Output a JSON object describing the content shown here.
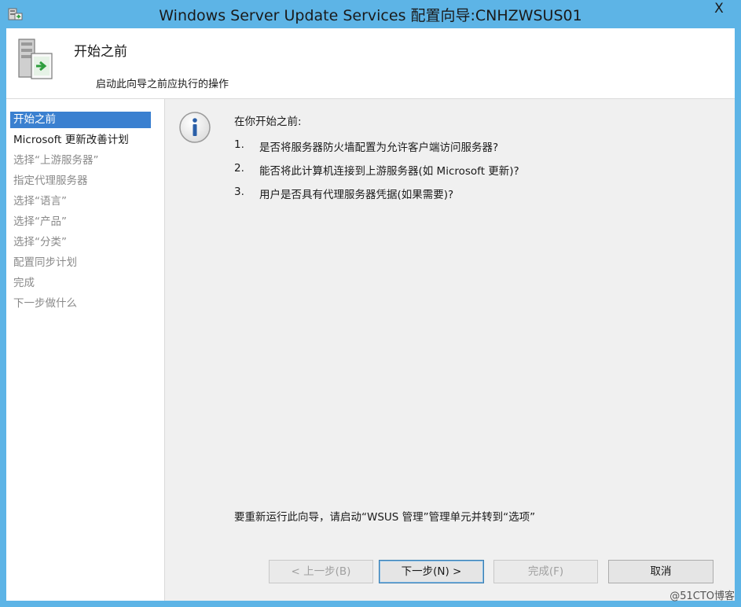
{
  "window": {
    "title": "Windows Server Update Services 配置向导:CNHZWSUS01",
    "close_glyph": "X",
    "accent_color": "#5db4e6"
  },
  "header": {
    "title": "开始之前",
    "subtitle": "启动此向导之前应执行的操作",
    "icon": "server-wizard-icon"
  },
  "sidebar": {
    "items": [
      {
        "label": "开始之前",
        "state": "active"
      },
      {
        "label": "Microsoft 更新改善计划",
        "state": "enabled"
      },
      {
        "label": "选择“上游服务器”",
        "state": "disabled"
      },
      {
        "label": "指定代理服务器",
        "state": "disabled"
      },
      {
        "label": "选择“语言”",
        "state": "disabled"
      },
      {
        "label": "选择“产品”",
        "state": "disabled"
      },
      {
        "label": "选择“分类”",
        "state": "disabled"
      },
      {
        "label": "配置同步计划",
        "state": "disabled"
      },
      {
        "label": "完成",
        "state": "disabled"
      },
      {
        "label": "下一步做什么",
        "state": "disabled"
      }
    ],
    "selection_color": "#3a80d0"
  },
  "main": {
    "info_icon": "info-icon",
    "intro": "在你开始之前:",
    "questions": [
      {
        "num": "1.",
        "text": "是否将服务器防火墙配置为允许客户端访问服务器?"
      },
      {
        "num": "2.",
        "text": "能否将此计算机连接到上游服务器(如 Microsoft 更新)?"
      },
      {
        "num": "3.",
        "text": "用户是否具有代理服务器凭据(如果需要)?"
      }
    ],
    "footer_note": "要重新运行此向导，请启动“WSUS 管理”管理单元并转到“选项”"
  },
  "buttons": {
    "back": "< 上一步(B)",
    "next": "下一步(N) >",
    "finish": "完成(F)",
    "cancel": "取消"
  },
  "watermark": "@51CTO博客"
}
